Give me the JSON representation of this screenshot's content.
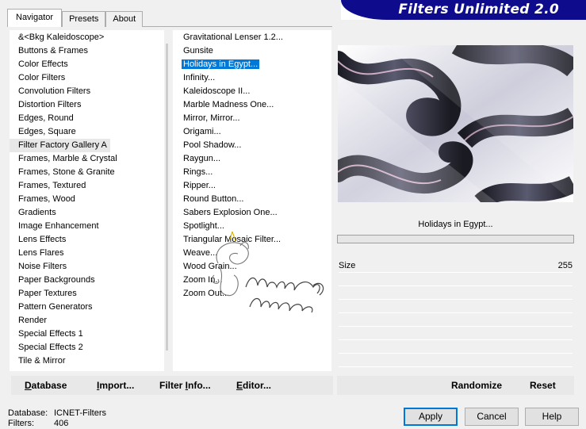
{
  "tabs": [
    {
      "label": "Navigator"
    },
    {
      "label": "Presets"
    },
    {
      "label": "About"
    }
  ],
  "banner": {
    "title": "Filters Unlimited 2.0",
    "color": "#0e0c8c"
  },
  "categories": [
    {
      "label": "&<Bkg Kaleidoscope>"
    },
    {
      "label": "Buttons & Frames"
    },
    {
      "label": "Color Effects"
    },
    {
      "label": "Color Filters"
    },
    {
      "label": "Convolution Filters"
    },
    {
      "label": "Distortion Filters"
    },
    {
      "label": "Edges, Round"
    },
    {
      "label": "Edges, Square"
    },
    {
      "label": "Filter Factory Gallery A"
    },
    {
      "label": "Frames, Marble & Crystal"
    },
    {
      "label": "Frames, Stone & Granite"
    },
    {
      "label": "Frames, Textured"
    },
    {
      "label": "Frames, Wood"
    },
    {
      "label": "Gradients"
    },
    {
      "label": "Image Enhancement"
    },
    {
      "label": "Lens Effects"
    },
    {
      "label": "Lens Flares"
    },
    {
      "label": "Noise Filters"
    },
    {
      "label": "Paper Backgrounds"
    },
    {
      "label": "Paper Textures"
    },
    {
      "label": "Pattern Generators"
    },
    {
      "label": "Render"
    },
    {
      "label": "Special Effects 1"
    },
    {
      "label": "Special Effects 2"
    },
    {
      "label": "Tile & Mirror"
    }
  ],
  "selected_category": "Filter Factory Gallery A",
  "filters": [
    {
      "label": "Gravitational Lenser 1.2..."
    },
    {
      "label": "Gunsite"
    },
    {
      "label": "Holidays in Egypt..."
    },
    {
      "label": "Infinity..."
    },
    {
      "label": "Kaleidoscope II..."
    },
    {
      "label": "Marble Madness One..."
    },
    {
      "label": "Mirror, Mirror..."
    },
    {
      "label": "Origami..."
    },
    {
      "label": "Pool Shadow..."
    },
    {
      "label": "Raygun..."
    },
    {
      "label": "Rings..."
    },
    {
      "label": "Ripper..."
    },
    {
      "label": "Round Button..."
    },
    {
      "label": "Sabers Explosion One..."
    },
    {
      "label": "Spotlight..."
    },
    {
      "label": "Triangular Mosaic Filter..."
    },
    {
      "label": "Weave..."
    },
    {
      "label": "Wood Grain..."
    },
    {
      "label": "Zoom In..."
    },
    {
      "label": "Zoom Out..."
    }
  ],
  "selected_filter": "Holidays in Egypt...",
  "params": {
    "title": "Holidays in Egypt...",
    "rows": [
      {
        "label": "Size",
        "value": "255"
      }
    ]
  },
  "toolbar": {
    "database_prefix": "D",
    "database_rest": "atabase",
    "import_prefix": "I",
    "import_rest": "mport...",
    "filter_info_prefix": "Filter ",
    "filter_info_ul": "I",
    "filter_info_rest": "nfo...",
    "editor_prefix": "E",
    "editor_rest": "ditor...",
    "randomize": "Randomize",
    "reset": "Reset"
  },
  "status": {
    "database_label": "Database:",
    "database_value": "ICNET-Filters",
    "filters_label": "Filters:",
    "filters_value": "406"
  },
  "buttons": {
    "apply": "Apply",
    "cancel": "Cancel",
    "help": "Help"
  }
}
